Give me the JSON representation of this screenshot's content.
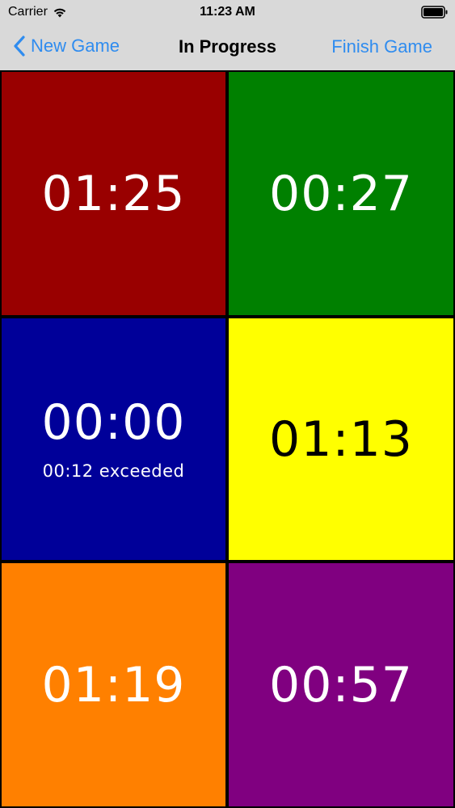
{
  "status_bar": {
    "carrier": "Carrier",
    "time": "11:23 AM",
    "wifi_icon": "wifi-icon",
    "battery_icon": "battery-icon"
  },
  "nav": {
    "back_label": "New Game",
    "back_icon": "chevron-left-icon",
    "title": "In Progress",
    "action_label": "Finish Game",
    "accent_color": "#2f8cef"
  },
  "timers": [
    {
      "time": "01:25",
      "note": "",
      "color": "#990000",
      "text_color": "#ffffff"
    },
    {
      "time": "00:27",
      "note": "",
      "color": "#008000",
      "text_color": "#ffffff"
    },
    {
      "time": "00:00",
      "note": "00:12 exceeded",
      "color": "#000099",
      "text_color": "#ffffff"
    },
    {
      "time": "01:13",
      "note": "",
      "color": "#ffff00",
      "text_color": "#000000"
    },
    {
      "time": "01:19",
      "note": "",
      "color": "#ff8000",
      "text_color": "#ffffff"
    },
    {
      "time": "00:57",
      "note": "",
      "color": "#800080",
      "text_color": "#ffffff"
    }
  ]
}
